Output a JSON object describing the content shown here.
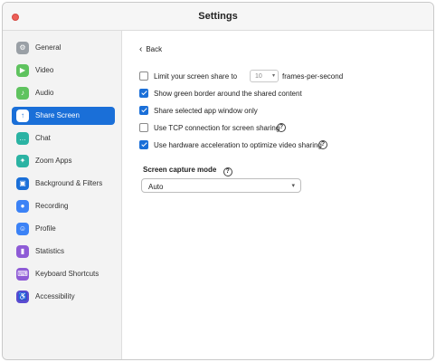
{
  "window": {
    "title": "Settings"
  },
  "sidebar": {
    "items": [
      {
        "label": "General",
        "icon": "gear-icon",
        "color": "#9aa0a6",
        "glyph": "⚙"
      },
      {
        "label": "Video",
        "icon": "video-camera-icon",
        "color": "#5fc35f",
        "glyph": "▶"
      },
      {
        "label": "Audio",
        "icon": "headphones-icon",
        "color": "#5fc35f",
        "glyph": "♪"
      },
      {
        "label": "Share Screen",
        "icon": "share-screen-icon",
        "color": "#1a6fd8",
        "glyph": "↑",
        "active": true
      },
      {
        "label": "Chat",
        "icon": "chat-bubble-icon",
        "color": "#2bb3a3",
        "glyph": "…"
      },
      {
        "label": "Zoom Apps",
        "icon": "apps-icon",
        "color": "#2bb3a3",
        "glyph": "✦"
      },
      {
        "label": "Background & Filters",
        "icon": "background-icon",
        "color": "#1a6fd8",
        "glyph": "▣"
      },
      {
        "label": "Recording",
        "icon": "record-icon",
        "color": "#3b82f6",
        "glyph": "●"
      },
      {
        "label": "Profile",
        "icon": "person-icon",
        "color": "#3b82f6",
        "glyph": "☺"
      },
      {
        "label": "Statistics",
        "icon": "bar-chart-icon",
        "color": "#8e5bd6",
        "glyph": "▮"
      },
      {
        "label": "Keyboard Shortcuts",
        "icon": "keyboard-icon",
        "color": "#8e5bd6",
        "glyph": "⌨"
      },
      {
        "label": "Accessibility",
        "icon": "accessibility-icon",
        "color": "#5a4bd1",
        "glyph": "♿"
      }
    ]
  },
  "main": {
    "back_label": "Back",
    "options": {
      "limit": {
        "label": "Limit your screen share to",
        "checked": false,
        "fps_value": "10",
        "suffix": "frames-per-second"
      },
      "green_border": {
        "label": "Show green border around the shared content",
        "checked": true
      },
      "selected_app": {
        "label": "Share selected app window only",
        "checked": true
      },
      "tcp": {
        "label": "Use TCP connection for screen sharing",
        "checked": false
      },
      "hw_accel": {
        "label": "Use hardware acceleration to optimize video sharing",
        "checked": true
      }
    },
    "capture_mode": {
      "title": "Screen capture mode",
      "value": "Auto"
    }
  },
  "colors": {
    "accent": "#1a6fd8",
    "close": "#ec5f58"
  }
}
